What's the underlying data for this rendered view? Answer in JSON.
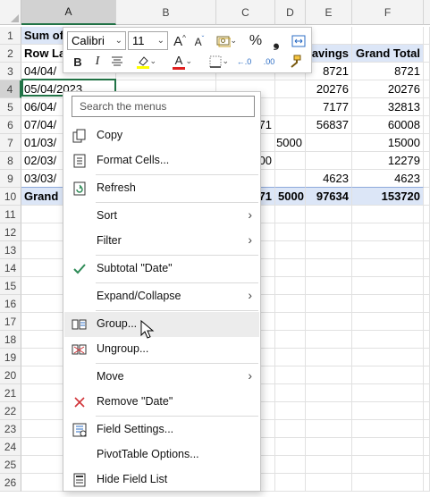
{
  "columns": [
    "A",
    "B",
    "C",
    "D",
    "E",
    "F"
  ],
  "rows": [
    "1",
    "2",
    "3",
    "4",
    "5",
    "6",
    "7",
    "8",
    "9",
    "10",
    "11",
    "12",
    "13",
    "14",
    "15",
    "16",
    "17",
    "18",
    "19",
    "20",
    "21",
    "22",
    "23",
    "24",
    "25",
    "26"
  ],
  "cells": {
    "r1_a": "Sum of",
    "r2_a": "Row La",
    "r2_e": "avings",
    "r2_f": "Grand Total",
    "r3_a": "04/04/",
    "r3_e": "8721",
    "r3_f": "8721",
    "r4_a": "05/04/2023",
    "r4_e": "20276",
    "r4_f": "20276",
    "r5_a": "06/04/",
    "r5_e": "7177",
    "r5_f": "32813",
    "r6_a": "07/04/",
    "r6_c": "71",
    "r6_e": "56837",
    "r6_f": "60008",
    "r7_a": "01/03/",
    "r7_d": "5000",
    "r7_f": "15000",
    "r8_a": "02/03/",
    "r8_c": "00",
    "r8_f": "12279",
    "r9_a": "03/03/",
    "r9_e": "4623",
    "r9_f": "4623",
    "r10_a": "Grand",
    "r10_c": "71",
    "r10_d": "5000",
    "r10_e": "97634",
    "r10_f": "153720"
  },
  "mini_toolbar": {
    "font_name": "Calibri",
    "font_size": "11",
    "grow_font": "A",
    "shrink_font": "A",
    "percent": "%",
    "comma": "❟",
    "bold": "B",
    "italic": "I",
    "font_color_letter": "A",
    "decrease_decimal": "←.0",
    "increase_decimal": ".00"
  },
  "menu": {
    "search_placeholder": "Search the menus",
    "items": [
      {
        "label": "Copy"
      },
      {
        "label": "Format Cells..."
      },
      {
        "label": "Refresh"
      },
      {
        "label": "Sort"
      },
      {
        "label": "Filter"
      },
      {
        "label": "Subtotal \"Date\""
      },
      {
        "label": "Expand/Collapse"
      },
      {
        "label": "Group..."
      },
      {
        "label": "Ungroup..."
      },
      {
        "label": "Move"
      },
      {
        "label": "Remove \"Date\""
      },
      {
        "label": "Field Settings..."
      },
      {
        "label": "PivotTable Options..."
      },
      {
        "label": "Hide Field List"
      }
    ]
  },
  "colors": {
    "excel_green": "#217346",
    "pivot_header_blue": "#dce6f7",
    "check_green": "#2e8b57",
    "remove_red": "#d13438"
  }
}
